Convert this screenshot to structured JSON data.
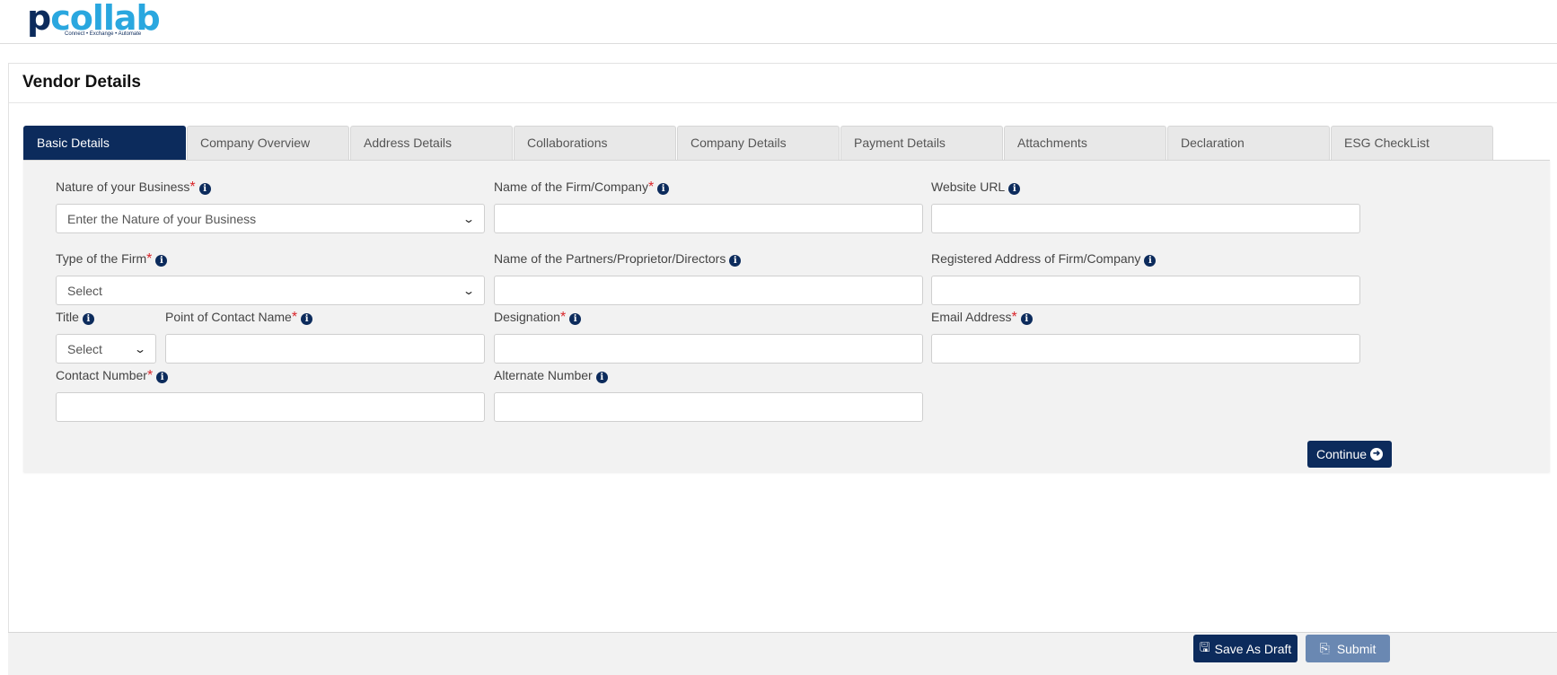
{
  "brand": {
    "name_part1": "p",
    "name_part2": "collab",
    "tagline": "Connect • Exchange • Automate"
  },
  "page": {
    "title": "Vendor Details"
  },
  "tabs": [
    {
      "label": "Basic Details",
      "active": true
    },
    {
      "label": "Company Overview"
    },
    {
      "label": "Address Details"
    },
    {
      "label": "Collaborations"
    },
    {
      "label": "Company Details"
    },
    {
      "label": "Payment Details"
    },
    {
      "label": "Attachments"
    },
    {
      "label": "Declaration"
    },
    {
      "label": "ESG CheckList"
    }
  ],
  "form": {
    "nature_of_business": {
      "label": "Nature of your Business",
      "required": "*",
      "value": "Enter the Nature of your Business"
    },
    "firm_name": {
      "label": "Name of the Firm/Company",
      "required": "*",
      "value": ""
    },
    "website_url": {
      "label": "Website URL",
      "value": ""
    },
    "firm_type": {
      "label": "Type of the Firm",
      "required": "*",
      "value": "Select"
    },
    "partners_names": {
      "label": "Name of the Partners/Proprietor/Directors",
      "value": ""
    },
    "registered_address": {
      "label": "Registered Address of Firm/Company",
      "value": ""
    },
    "title": {
      "label": "Title",
      "value": "Select"
    },
    "contact_name": {
      "label": "Point of Contact Name",
      "required": "*",
      "value": ""
    },
    "designation": {
      "label": "Designation",
      "required": "*",
      "value": ""
    },
    "email": {
      "label": "Email Address",
      "required": "*",
      "value": ""
    },
    "contact_number": {
      "label": "Contact Number",
      "required": "*",
      "value": ""
    },
    "alternate_number": {
      "label": "Alternate Number",
      "value": ""
    }
  },
  "icons": {
    "info": "i"
  },
  "buttons": {
    "continue": "Continue",
    "save_draft": "Save As Draft",
    "submit": "Submit"
  },
  "colors": {
    "primary": "#0c2b5c",
    "accent": "#2aa7df",
    "required": "#d9252a"
  }
}
